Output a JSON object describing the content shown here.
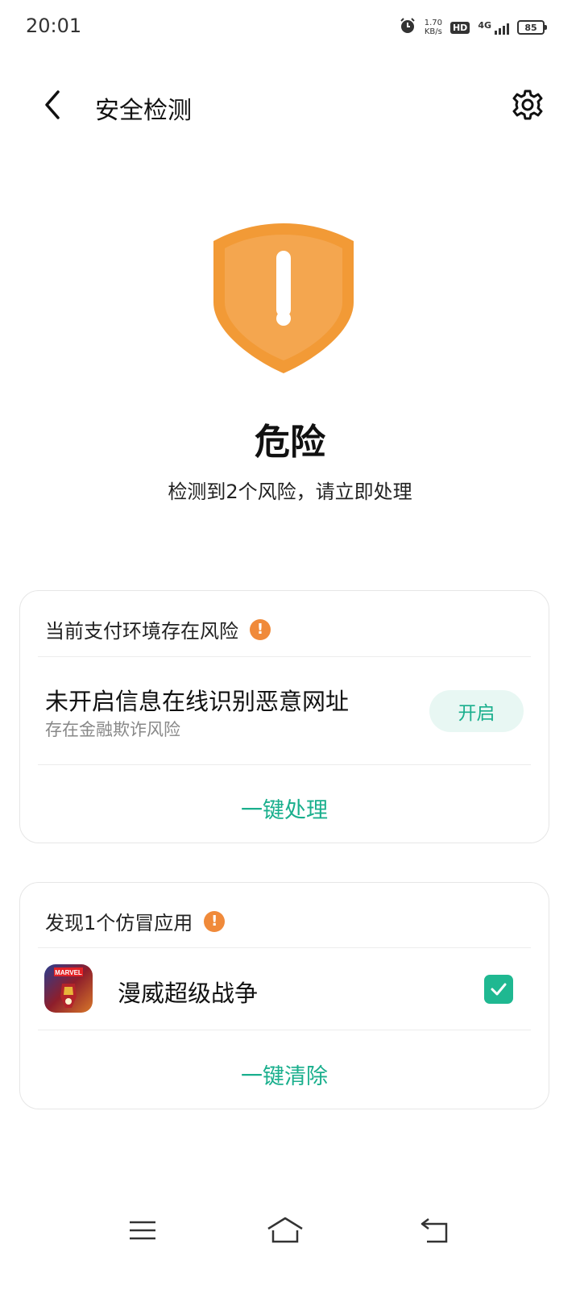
{
  "status_bar": {
    "time": "20:01",
    "net_speed_value": "1.70",
    "net_speed_unit": "KB/s",
    "hd_label": "HD",
    "network_label": "4G",
    "battery_level": "85",
    "icons": [
      "alarm-icon",
      "hd-icon",
      "signal-icon",
      "battery-icon"
    ]
  },
  "header": {
    "title": "安全检测",
    "back_icon": "back-arrow-icon",
    "settings_icon": "gear-icon"
  },
  "hero": {
    "icon": "warning-shield-icon",
    "status": "危险",
    "description": "检测到2个风险，请立即处理"
  },
  "payment_card": {
    "title": "当前支付环境存在风险",
    "warning_glyph": "!",
    "item_title": "未开启信息在线识别恶意网址",
    "item_subtitle": "存在金融欺诈风险",
    "enable_button": "开启",
    "action_label": "一键处理"
  },
  "fake_app_card": {
    "title": "发现1个仿冒应用",
    "warning_glyph": "!",
    "apps": [
      {
        "name": "漫威超级战争",
        "icon_text": "MARVEL",
        "checked": true
      }
    ],
    "action_label": "一键清除"
  },
  "nav_bar": {
    "icons": [
      "menu-icon",
      "home-icon",
      "back-icon"
    ]
  },
  "colors": {
    "accent": "#1aaf8d",
    "warning": "#f08a3a",
    "shield_outer": "#f29a36",
    "shield_inner": "#f4a64f"
  }
}
